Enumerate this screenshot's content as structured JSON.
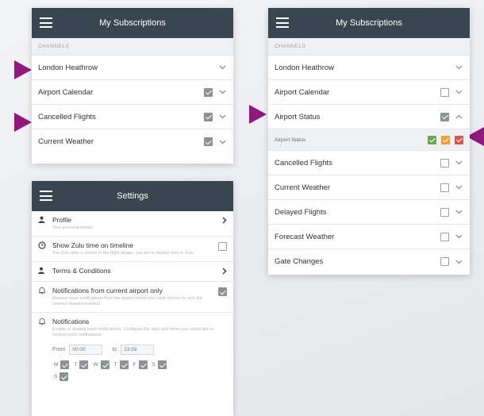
{
  "colors": {
    "header_bg": "#37464f",
    "arrow": "#8e1a7e",
    "status_green": "#6aa84f",
    "status_yellow": "#e8a23a",
    "status_red": "#d9534f"
  },
  "subs_small": {
    "title": "My Subscriptions",
    "section": "CHANNELS",
    "rows": [
      {
        "label": "London Heathrow"
      },
      {
        "label": "Airport Calendar"
      },
      {
        "label": "Cancelled Flights"
      },
      {
        "label": "Current Weather"
      }
    ]
  },
  "subs_large": {
    "title": "My Subscriptions",
    "section": "CHANNELS",
    "rows": [
      {
        "label": "London Heathrow"
      },
      {
        "label": "Airport Calendar"
      },
      {
        "label": "Airport Status"
      },
      {
        "label": "Airport Status"
      },
      {
        "label": "Cancelled Flights"
      },
      {
        "label": "Current Weather"
      },
      {
        "label": "Delayed Flights"
      },
      {
        "label": "Forecast Weather"
      },
      {
        "label": "Gate Changes"
      }
    ]
  },
  "settings": {
    "title": "Settings",
    "profile": {
      "label": "Profile",
      "sub": "Your personal details"
    },
    "zulu": {
      "label": "Show Zulu time on timeline",
      "sub": "The Zulu time is shown in the flight details, you set to display time in Zulu."
    },
    "terms": {
      "label": "Terms & Conditions"
    },
    "notif_airport": {
      "label": "Notifications from current airport only",
      "sub": "Receive push notifications from the airport where you have chosen to only the nearest departure/arrival."
    },
    "notif": {
      "label": "Notifications",
      "sub": "Enable or disable push notifications. Configure the days and times you would like to receive push notifications."
    },
    "from_label": "From",
    "from_value": "00:00",
    "to_label": "to",
    "to_value": "23:59",
    "days": [
      "M",
      "T",
      "W",
      "T",
      "F",
      "S",
      "S"
    ]
  }
}
